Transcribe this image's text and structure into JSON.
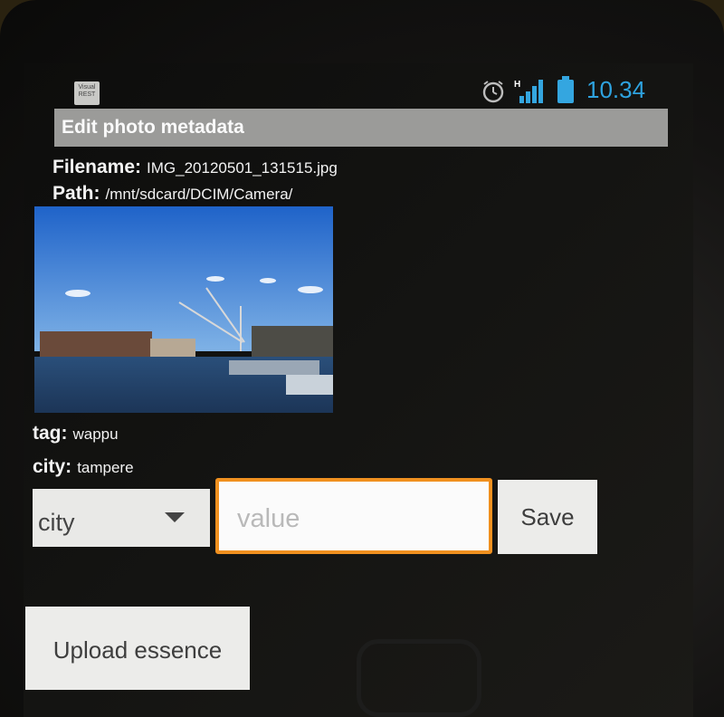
{
  "statusbar": {
    "app_icon_label": "Visual REST",
    "clock": "10.34",
    "network_label": "H",
    "accent_color": "#2ea3e0",
    "icons": [
      "alarm-icon",
      "signal-icon",
      "battery-icon"
    ]
  },
  "title": "Edit photo metadata",
  "file": {
    "filename_label": "Filename:",
    "filename_value": "IMG_20120501_131515.jpg",
    "path_label": "Path:",
    "path_value": "/mnt/sdcard/DCIM/Camera/"
  },
  "metadata": [
    {
      "key": "tag:",
      "value": "wappu"
    },
    {
      "key": "city:",
      "value": "tampere"
    }
  ],
  "editor": {
    "selected_key": "city",
    "value_placeholder": "value",
    "save_label": "Save"
  },
  "upload_label": "Upload essence",
  "colors": {
    "focus_border": "#f0901f",
    "titlebar_bg": "#9b9b99"
  }
}
